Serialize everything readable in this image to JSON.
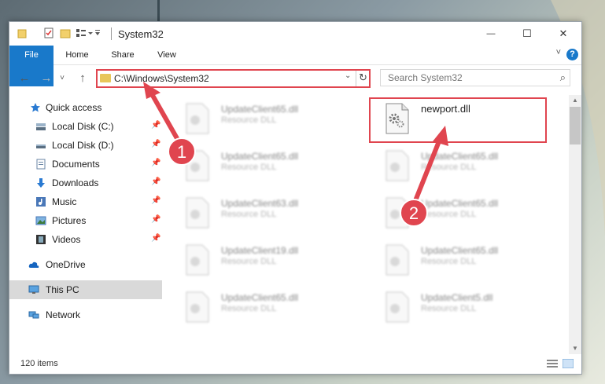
{
  "window": {
    "title": "System32",
    "controls": {
      "minimize": "—",
      "maximize": "☐",
      "close": "✕"
    }
  },
  "ribbon": {
    "tabs": [
      "File",
      "Home",
      "Share",
      "View"
    ],
    "help": "?"
  },
  "nav": {
    "back": "←",
    "forward": "→",
    "recent": "˅",
    "up": "↑",
    "address": "C:\\Windows\\System32",
    "dropdown": "⌄",
    "refresh": "↻",
    "search_placeholder": "Search System32",
    "search_icon": "⌕"
  },
  "sidebar": {
    "items": [
      {
        "label": "Quick access",
        "icon": "star-icon"
      },
      {
        "label": "Local Disk (C:)",
        "icon": "drive-icon",
        "pinned": true
      },
      {
        "label": "Local Disk (D:)",
        "icon": "drive-icon",
        "pinned": true
      },
      {
        "label": "Documents",
        "icon": "documents-icon",
        "pinned": true
      },
      {
        "label": "Downloads",
        "icon": "downloads-icon",
        "pinned": true
      },
      {
        "label": "Music",
        "icon": "music-icon",
        "pinned": true
      },
      {
        "label": "Pictures",
        "icon": "pictures-icon",
        "pinned": true
      },
      {
        "label": "Videos",
        "icon": "videos-icon",
        "pinned": true
      },
      {
        "label": "OneDrive",
        "icon": "cloud-icon"
      },
      {
        "label": "This PC",
        "icon": "computer-icon",
        "selected": true
      },
      {
        "label": "Network",
        "icon": "network-icon"
      }
    ],
    "pin_glyph": "📌"
  },
  "files": {
    "left": [
      {
        "name": "UpdateClient65.dll",
        "type": "Resource DLL"
      },
      {
        "name": "UpdateClient65.dll",
        "type": "Resource DLL"
      },
      {
        "name": "UpdateClient63.dll",
        "type": "Resource DLL"
      },
      {
        "name": "UpdateClient19.dll",
        "type": "Resource DLL"
      },
      {
        "name": "UpdateClient65.dll",
        "type": "Resource DLL"
      }
    ],
    "right": [
      {
        "name": "newport.dll",
        "type": ""
      },
      {
        "name": "UpdateClient65.dll",
        "type": "Resource DLL"
      },
      {
        "name": "UpdateClient65.dll",
        "type": "Resource DLL"
      },
      {
        "name": "UpdateClient65.dll",
        "type": "Resource DLL"
      },
      {
        "name": "UpdateClient5.dll",
        "type": "Resource DLL"
      }
    ]
  },
  "status": {
    "item_count": "120 items"
  },
  "annotations": {
    "step1": "1",
    "step2": "2",
    "color": "#e0454f"
  },
  "colors": {
    "accent": "#1979ca",
    "highlight": "#e0454f",
    "selected_bg": "#d9d9d9"
  }
}
